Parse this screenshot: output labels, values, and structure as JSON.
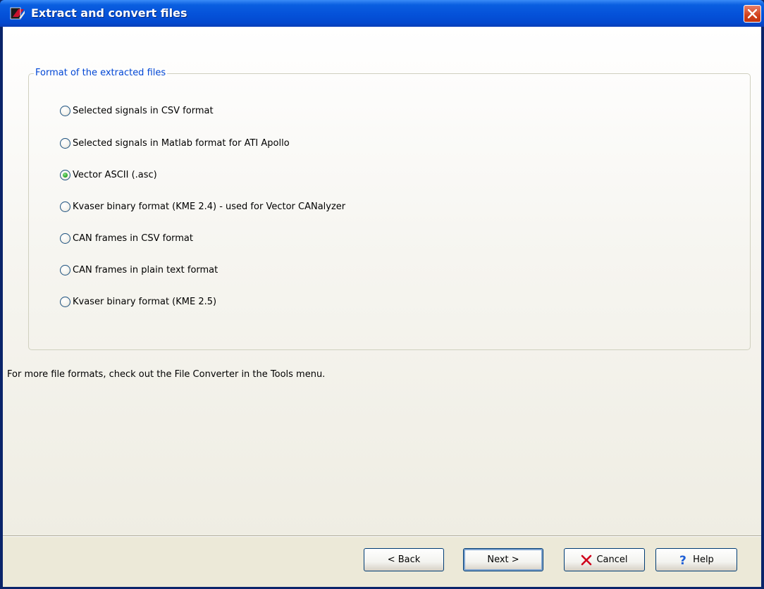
{
  "window": {
    "title": "Extract and convert files"
  },
  "group": {
    "legend": "Format of the extracted files",
    "options": [
      {
        "label": "Selected signals in CSV format",
        "checked": false
      },
      {
        "label": "Selected signals in Matlab format for ATI Apollo",
        "checked": false
      },
      {
        "label": "Vector ASCII (.asc)",
        "checked": true
      },
      {
        "label": "Kvaser binary format (KME 2.4) - used for Vector CANalyzer",
        "checked": false
      },
      {
        "label": "CAN frames in CSV format",
        "checked": false
      },
      {
        "label": "CAN frames in plain text format",
        "checked": false
      },
      {
        "label": "Kvaser binary format (KME 2.5)",
        "checked": false
      }
    ]
  },
  "hint": "For more file formats, check out the File Converter in the Tools menu.",
  "buttons": {
    "back": "< Back",
    "next": "Next >",
    "cancel": "Cancel",
    "help": "Help"
  },
  "icons": {
    "app": "app-logo-icon",
    "close": "close-icon",
    "cancel": "red-x-icon",
    "help": "question-mark-icon"
  },
  "colors": {
    "titlebar": "#0553DA",
    "legend_text": "#0046D5",
    "close_button": "#D2411B",
    "checked_radio": "#21A121"
  }
}
